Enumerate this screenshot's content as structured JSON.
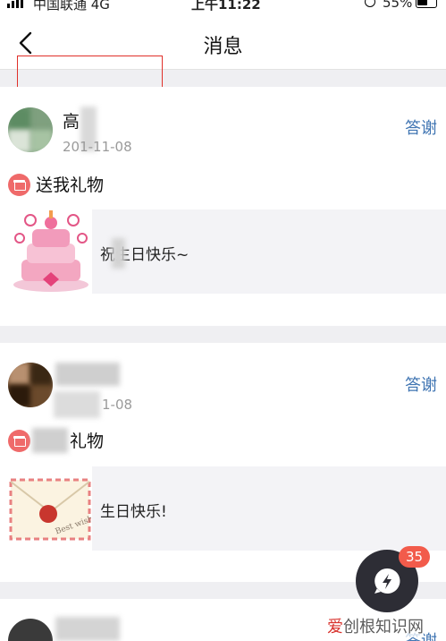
{
  "status_bar": {
    "carrier": "中国联通  4G",
    "time": "上午11:22",
    "battery": "55%"
  },
  "nav": {
    "title": "消息"
  },
  "messages": [
    {
      "name": "高",
      "date": "201-11-08",
      "thanks": "答谢",
      "gift_line": "送我礼物",
      "gift_msg": "祝生日快乐~",
      "gift_image": "cake-image"
    },
    {
      "name": "",
      "date": "1-08",
      "thanks": "答谢",
      "gift_line": "礼物",
      "gift_msg": "生日快乐!",
      "gift_image": "envelope-image"
    },
    {
      "thanks": "答谢"
    }
  ],
  "fab": {
    "badge": "35",
    "icon": "lightning-chat-icon"
  },
  "watermark": {
    "part1": "爱",
    "part2": "创根知识网"
  },
  "colors": {
    "accent_blue": "#3f74b2",
    "badge_red": "#f25b4b",
    "gift_red": "#ef6a6a"
  }
}
